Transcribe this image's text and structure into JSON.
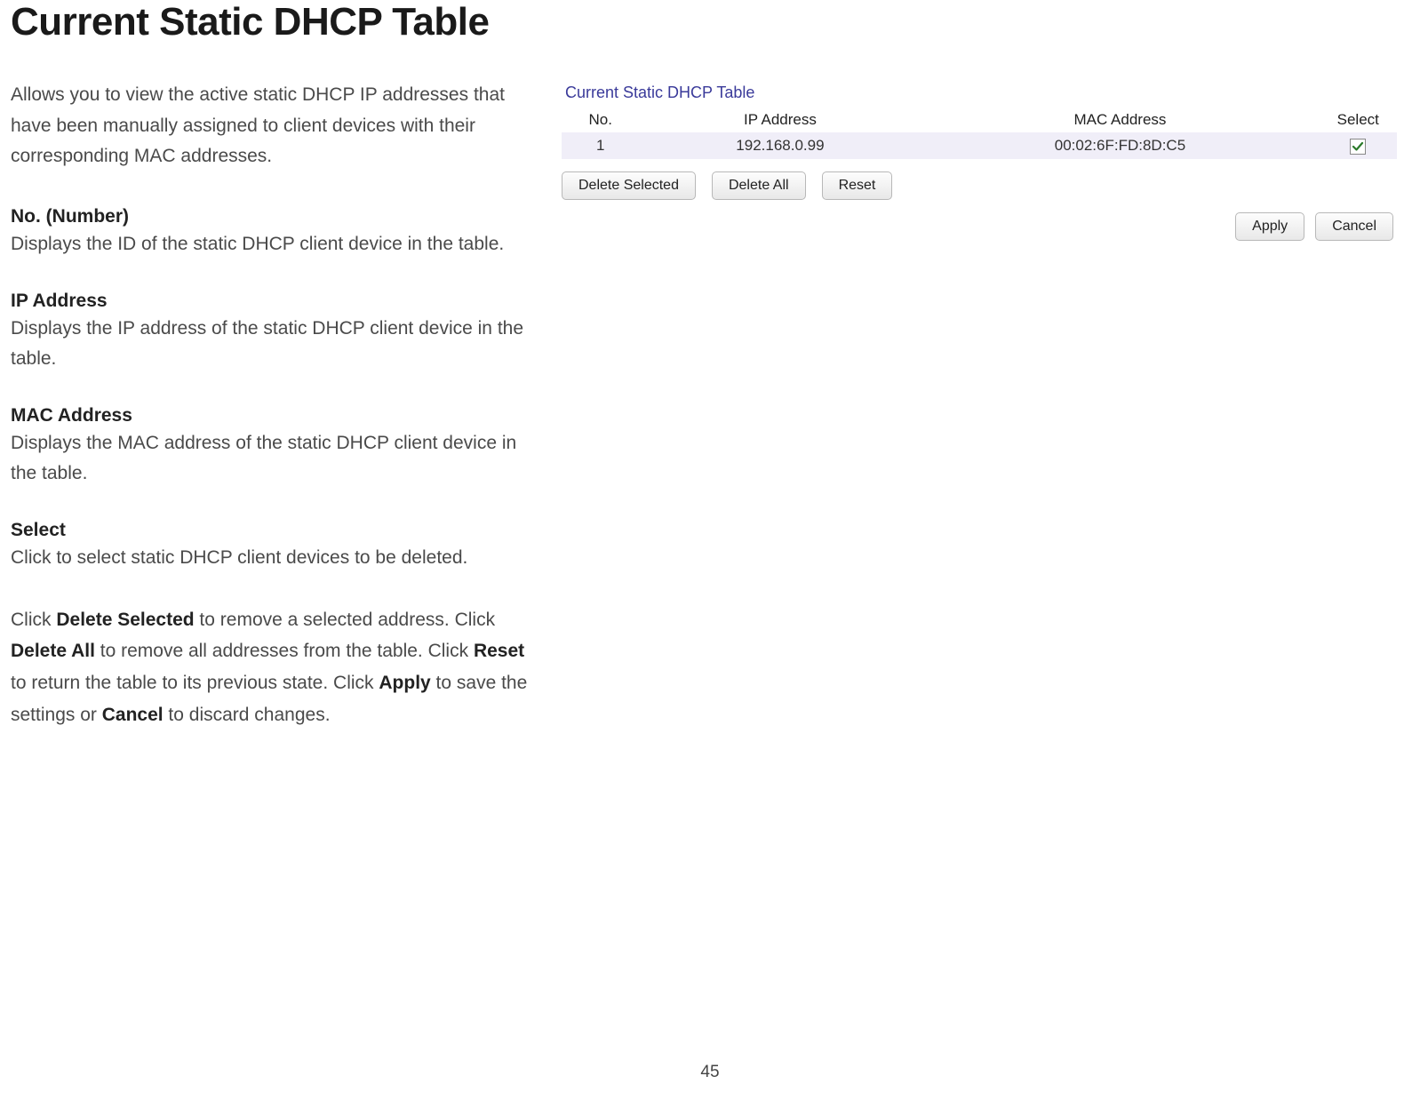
{
  "page_title": "Current Static DHCP Table",
  "intro": "Allows you to view the active static DHCP IP addresses that have been manually assigned to client devices with their corresponding MAC addresses.",
  "sections": [
    {
      "heading": "No. (Number)",
      "body": "Displays the ID of the static DHCP client device in the table."
    },
    {
      "heading": "IP Address",
      "body": "Displays the IP address of the static DHCP client device in the table."
    },
    {
      "heading": "MAC Address",
      "body": "Displays the MAC address of the static DHCP client device in the table."
    },
    {
      "heading": "Select",
      "body": "Click to select static DHCP client devices to be deleted."
    }
  ],
  "footer": {
    "t0": "Click ",
    "b0": "Delete Selected",
    "t1": " to remove a selected address. Click ",
    "b1": "Delete All",
    "t2": " to remove all addresses from the table. Click ",
    "b2": "Reset",
    "t3": " to return the table to its previous state. Click ",
    "b3": "Apply",
    "t4": " to save the settings or ",
    "b4": "Cancel",
    "t5": " to discard changes."
  },
  "screenshot": {
    "title": "Current Static DHCP Table",
    "columns": {
      "no": "No.",
      "ip": "IP Address",
      "mac": "MAC Address",
      "select": "Select"
    },
    "rows": [
      {
        "no": "1",
        "ip": "192.168.0.99",
        "mac": "00:02:6F:FD:8D:C5",
        "selected": true
      }
    ],
    "buttons": {
      "delete_selected": "Delete Selected",
      "delete_all": "Delete All",
      "reset": "Reset",
      "apply": "Apply",
      "cancel": "Cancel"
    }
  },
  "page_number": "45"
}
